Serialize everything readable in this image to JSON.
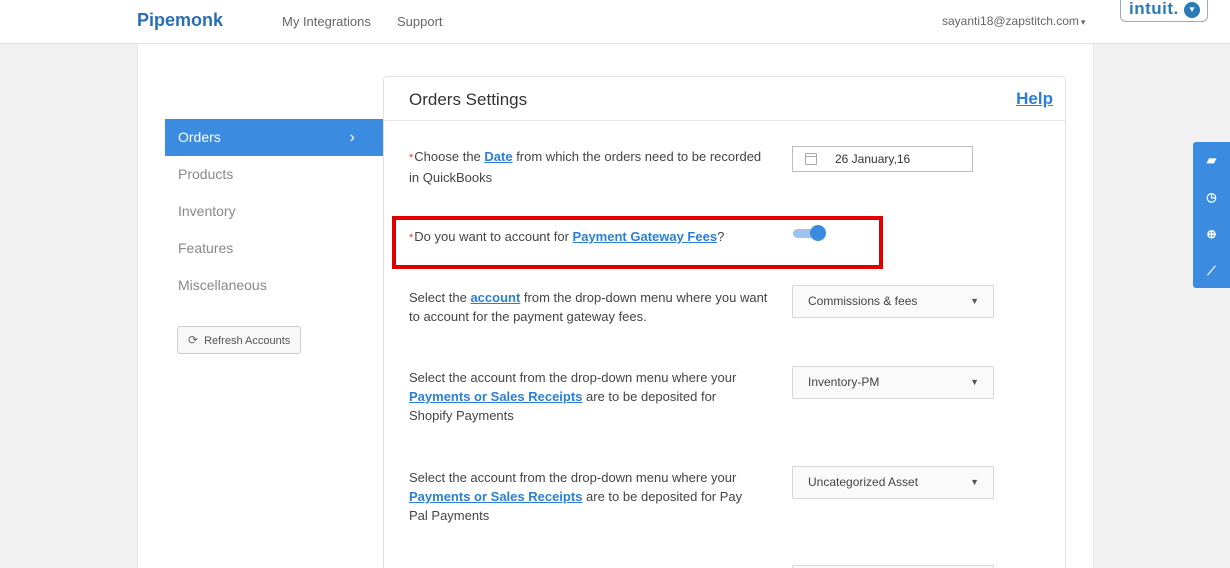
{
  "nav": {
    "brand": "Pipemonk",
    "integrations": "My Integrations",
    "support": "Support",
    "user": "sayanti18@zapstitch.com",
    "intuit_logo": "intuit."
  },
  "sidebar": {
    "items": [
      {
        "label": "Orders"
      },
      {
        "label": "Products"
      },
      {
        "label": "Inventory"
      },
      {
        "label": "Features"
      },
      {
        "label": "Miscellaneous"
      }
    ],
    "refresh_label": "Refresh Accounts"
  },
  "panel": {
    "title": "Orders Settings",
    "help": "Help"
  },
  "settings": {
    "date": {
      "text_before": "Choose the ",
      "link": "Date",
      "text_after": " from which the orders need to be recorded in QuickBooks",
      "value": "26 January,16"
    },
    "gateway": {
      "text_before": "Do you want to account for ",
      "link": "Payment Gateway Fees",
      "text_after": "?",
      "toggle_state": "on"
    },
    "fee_account": {
      "text_before": "Select the ",
      "link": "account",
      "text_after": " from the drop-down menu where you want to account for the payment gateway fees.",
      "selected": "Commissions & fees"
    },
    "shopify_deposit": {
      "text_before": "Select the account from the drop-down menu where your ",
      "link": "Payments or Sales Receipts",
      "text_after": " are to be deposited for Shopify Payments",
      "selected": "Inventory-PM"
    },
    "paypal_deposit": {
      "text_before": "Select the account from the drop-down menu where your ",
      "link": "Payments or Sales Receipts",
      "text_after": " are to be deposited for Pay Pal Payments",
      "selected": "Uncategorized Asset"
    }
  },
  "tools": [
    "book-icon",
    "clock-icon",
    "lifebuoy-icon",
    "rss-icon"
  ],
  "colors": {
    "accent": "#3b8ce0",
    "link": "#2a7fd6",
    "highlight": "#e00000",
    "required": "#e03c3c"
  }
}
